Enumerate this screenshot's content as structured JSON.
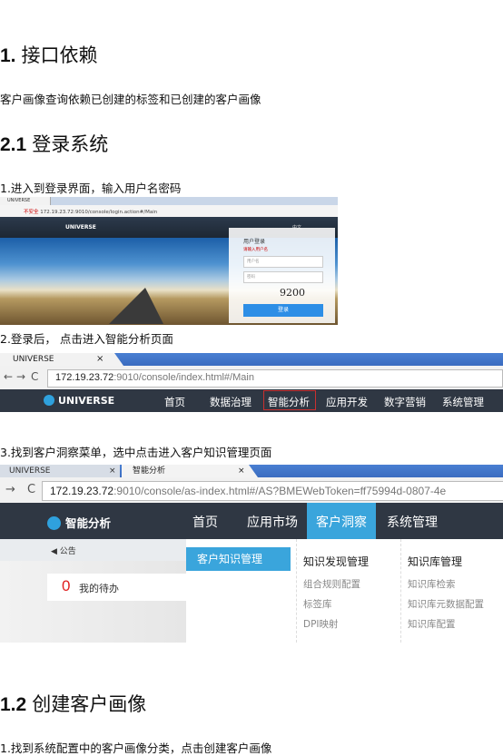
{
  "doc": {
    "h1_num": "1.",
    "h1_text": "接口依赖",
    "p1": "客户画像查询依赖已创建的标签和已创建的客户画像",
    "h21_num": "2.1",
    "h21_text": "登录系统",
    "step1": "1.进入到登录界面，输入用户名密码",
    "step2": "2.登录后，  点击进入智能分析页面",
    "step3": "3.找到客户洞察菜单，选中点击进入客户知识管理页面",
    "h12_num": "1.2",
    "h12_text": "创建客户画像",
    "step4": "1.找到系统配置中的客户画像分类，点击创建客户画像"
  },
  "shot1": {
    "tab": "UNIVERSE",
    "url_warn": "不安全",
    "url": "172.19.23.72:9010/console/login.action#/Main",
    "logo": "UNIVERSE",
    "lang": "中文",
    "login_title": "用户登录",
    "error": "请输入用户名",
    "user_placeholder": "用户名",
    "pass_placeholder": "密码",
    "captcha": "9200",
    "login_button": "登录"
  },
  "shot2": {
    "tab": "UNIVERSE",
    "tab_close": "×",
    "back": "←",
    "forward": "→",
    "reload": "C",
    "url_host": "172.19.23.72",
    "url_rest": ":9010/console/index.html#/Main",
    "logo": "UNIVERSE",
    "menu": [
      "首页",
      "数据治理",
      "智能分析",
      "应用开发",
      "数字营销",
      "系统管理"
    ]
  },
  "shot3": {
    "tab1": "UNIVERSE",
    "tab1_close": "×",
    "tab2": "智能分析",
    "tab2_close": "×",
    "back": "→",
    "reload": "C",
    "url_host": "172.19.23.72",
    "url_rest": ":9010/console/as-index.html#/AS?BMEWebToken=ff75994d-0807-4e",
    "logo": "智能分析",
    "menu": [
      "首页",
      "应用市场",
      "客户洞察",
      "系统管理"
    ],
    "notice": "公告",
    "todo_count": "0",
    "todo_label": "我的待办",
    "selected": "客户知识管理",
    "col1_title": "知识发现管理",
    "col1_items": [
      "组合规则配置",
      "标签库",
      "DPI映射"
    ],
    "col2_title": "知识库管理",
    "col2_items": [
      "知识库检索",
      "知识库元数据配置",
      "知识库配置"
    ]
  }
}
